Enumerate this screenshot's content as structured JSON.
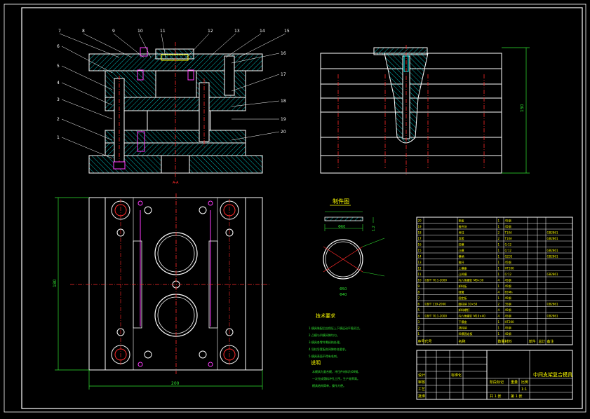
{
  "colors": {
    "background": "#000000",
    "frame": "#ffffff",
    "outline": "#ffffff",
    "hatch": "#00e5e5",
    "centerline": "#ff2a2a",
    "magenta": "#ff3cff",
    "green": "#32e632",
    "yellow": "#ffff00",
    "cyan": "#00ffff",
    "pink": "#ff66ff"
  },
  "front_view": {
    "callouts_top": [
      "7",
      "8",
      "9",
      "10",
      "11",
      "12",
      "13",
      "14",
      "15"
    ],
    "callouts_left": [
      "6",
      "5",
      "4",
      "3",
      "2",
      "1"
    ],
    "callouts_right": [
      "16",
      "17",
      "18",
      "19",
      "20"
    ],
    "section_mark": "A-A"
  },
  "plan_view": {
    "dim_width": "200",
    "dim_height": "180"
  },
  "side_view": {
    "dim_height": "150"
  },
  "part_view": {
    "title": "制件图",
    "dim_width": "Φ60",
    "dim_thick": "1.2",
    "notes": [
      "Φ50",
      "Φ40"
    ]
  },
  "notes": {
    "tech_title": "技术要求",
    "tech_lines": [
      "1.模具装配后应保证上下模运动平稳灵活。",
      "2.凸模与凹模间隙均匀。",
      "3.模具各零件需经热处理。",
      "4.导柱导套配合间隙符合要求。",
      "5.模具表面不得有毛刺。"
    ],
    "remark_title": "说明",
    "remark_lines": [
      "本模具为复合模，冲压件材料为08钢，",
      "一次完成落料冲孔工序，生产效率高。",
      "模具结构简单，操作方便。"
    ]
  },
  "bom": {
    "header": [
      "序号",
      "代号",
      "名称",
      "数量",
      "材料",
      "单件",
      "总计",
      "备注"
    ],
    "rows": [
      {
        "no": "20",
        "code": "",
        "name": "垫板",
        "qty": "1",
        "mat": "45钢",
        "note": ""
      },
      {
        "no": "19",
        "code": "",
        "name": "推件块",
        "qty": "1",
        "mat": "45钢",
        "note": ""
      },
      {
        "no": "18",
        "code": "",
        "name": "导柱",
        "qty": "2",
        "mat": "T10A",
        "note": "GB2861"
      },
      {
        "no": "17",
        "code": "",
        "name": "导套",
        "qty": "2",
        "mat": "T10A",
        "note": "GB2861"
      },
      {
        "no": "16",
        "code": "",
        "name": "凹模",
        "qty": "1",
        "mat": "Cr12",
        "note": ""
      },
      {
        "no": "15",
        "code": "",
        "name": "凸模",
        "qty": "1",
        "mat": "Cr12",
        "note": "GB2861"
      },
      {
        "no": "14",
        "code": "",
        "name": "模柄",
        "qty": "1",
        "mat": "Q235",
        "note": "GB2861"
      },
      {
        "no": "13",
        "code": "",
        "name": "推杆",
        "qty": "1",
        "mat": "45钢",
        "note": ""
      },
      {
        "no": "12",
        "code": "",
        "name": "上模座",
        "qty": "1",
        "mat": "HT200",
        "note": ""
      },
      {
        "no": "11",
        "code": "",
        "name": "凸凹模",
        "qty": "1",
        "mat": "Cr12",
        "note": "GB2861"
      },
      {
        "no": "10",
        "code": "GB/T 70.1-2000",
        "name": "内六角螺钉 M8×30",
        "qty": "4",
        "mat": "45钢",
        "note": ""
      },
      {
        "no": "9",
        "code": "",
        "name": "卸料板",
        "qty": "1",
        "mat": "45钢",
        "note": ""
      },
      {
        "no": "8",
        "code": "",
        "name": "弹簧",
        "qty": "4",
        "mat": "65Mn",
        "note": ""
      },
      {
        "no": "7",
        "code": "",
        "name": "固定板",
        "qty": "1",
        "mat": "45钢",
        "note": ""
      },
      {
        "no": "6",
        "code": "GB/T 119-2000",
        "name": "圆柱销 10×50",
        "qty": "2",
        "mat": "35钢",
        "note": "GB2861"
      },
      {
        "no": "5",
        "code": "",
        "name": "卸料螺钉",
        "qty": "4",
        "mat": "45钢",
        "note": ""
      },
      {
        "no": "4",
        "code": "GB/T 70.1-2000",
        "name": "内六角螺钉 M10×40",
        "qty": "4",
        "mat": "45钢",
        "note": "GB2861"
      },
      {
        "no": "3",
        "code": "",
        "name": "下模座",
        "qty": "1",
        "mat": "HT200",
        "note": ""
      },
      {
        "no": "2",
        "code": "",
        "name": "挡料销",
        "qty": "1",
        "mat": "45钢",
        "note": ""
      },
      {
        "no": "1",
        "code": "",
        "name": "凹模固定板",
        "qty": "1",
        "mat": "45钢",
        "note": ""
      }
    ]
  },
  "title_block": {
    "drawing_name": "中间支架复合模具",
    "scale_label": "比例",
    "scale": "1:1",
    "mark_label": "标记",
    "weight_label": "重量",
    "sheet_total": "共 1 张",
    "sheet_no": "第 1 张",
    "design_label": "设计",
    "check_label": "审核",
    "process_label": "工艺",
    "approve_label": "批准",
    "std_label": "标准化",
    "stage_label": "阶段标记"
  }
}
